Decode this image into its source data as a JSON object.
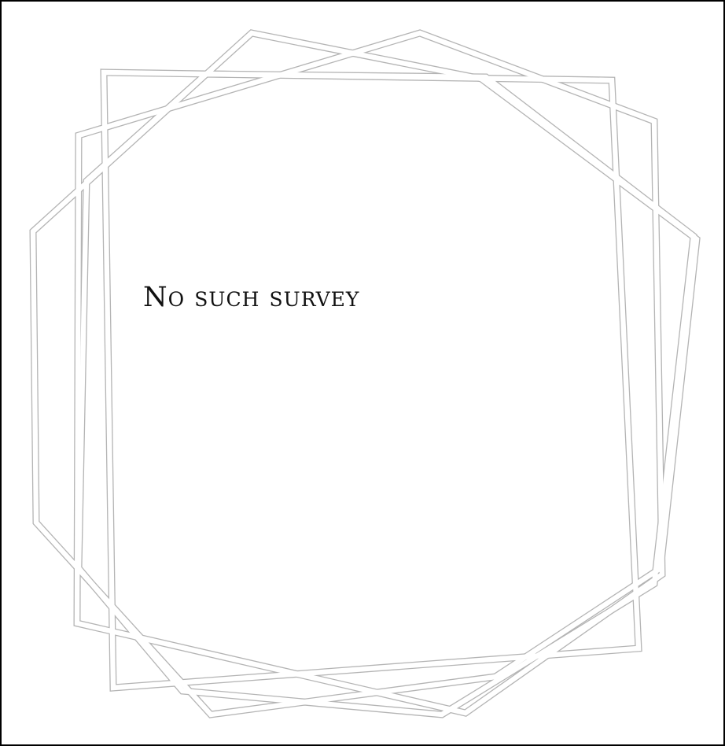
{
  "message": {
    "text": "No such survey"
  },
  "frame": {
    "icon": "geometric-frame-ornament",
    "stroke_color": "#b4b4b4",
    "fill_color": "#ffffff"
  },
  "page": {
    "background_color": "#ffffff",
    "border_color": "#000000"
  }
}
